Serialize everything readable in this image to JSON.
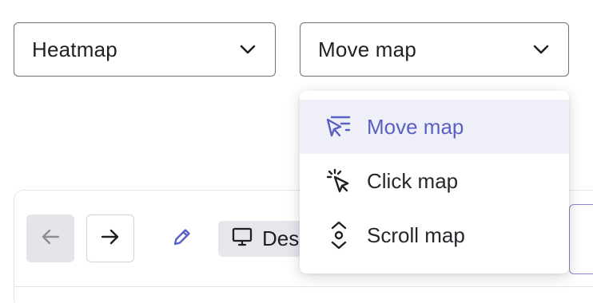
{
  "selectors": {
    "primary": {
      "value": "Heatmap"
    },
    "secondary": {
      "value": "Move map"
    }
  },
  "dropdown": {
    "items": [
      {
        "label": "Move map",
        "icon": "move-map-icon",
        "selected": true
      },
      {
        "label": "Click map",
        "icon": "click-map-icon",
        "selected": false
      },
      {
        "label": "Scroll map",
        "icon": "scroll-map-icon",
        "selected": false
      }
    ]
  },
  "toolbar": {
    "back_icon": "arrow-left-icon",
    "forward_icon": "arrow-right-icon",
    "edit_icon": "pencil-icon",
    "device_icon": "monitor-icon",
    "device_label": "Desktop"
  },
  "colors": {
    "accent": "#5a5fc4",
    "selected_bg": "#efeff7",
    "border": "#6f6f78"
  }
}
